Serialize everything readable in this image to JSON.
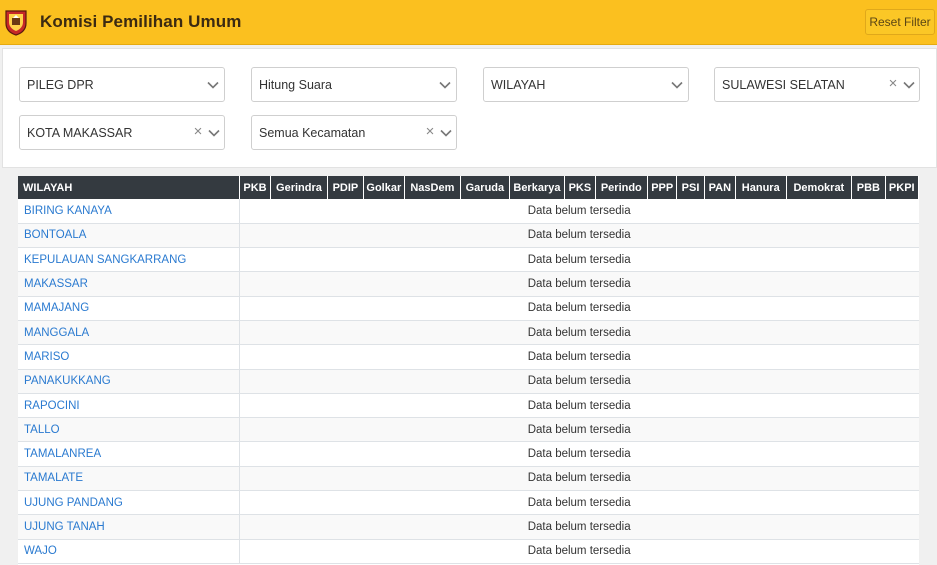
{
  "header": {
    "title": "Komisi Pemilihan Umum",
    "reset_label": "Reset Filter",
    "accent_color": "#fbc01f"
  },
  "filters": [
    {
      "value": "PILEG DPR",
      "clearable": false
    },
    {
      "value": "Hitung Suara",
      "clearable": false
    },
    {
      "value": "WILAYAH",
      "clearable": false
    },
    {
      "value": "SULAWESI SELATAN",
      "clearable": true
    },
    {
      "value": "KOTA MAKASSAR",
      "clearable": true
    },
    {
      "value": "Semua Kecamatan",
      "clearable": true
    }
  ],
  "table": {
    "columns": [
      "WILAYAH",
      "PKB",
      "Gerindra",
      "PDIP",
      "Golkar",
      "NasDem",
      "Garuda",
      "Berkarya",
      "PKS",
      "Perindo",
      "PPP",
      "PSI",
      "PAN",
      "Hanura",
      "Demokrat",
      "PBB",
      "PKPI"
    ],
    "empty_message": "Data belum tersedia",
    "rows": [
      "BIRING KANAYA",
      "BONTOALA",
      "KEPULAUAN SANGKARRANG",
      "MAKASSAR",
      "MAMAJANG",
      "MANGGALA",
      "MARISO",
      "PANAKUKKANG",
      "RAPOCINI",
      "TALLO",
      "TAMALANREA",
      "TAMALATE",
      "UJUNG PANDANG",
      "UJUNG TANAH",
      "WAJO"
    ]
  }
}
